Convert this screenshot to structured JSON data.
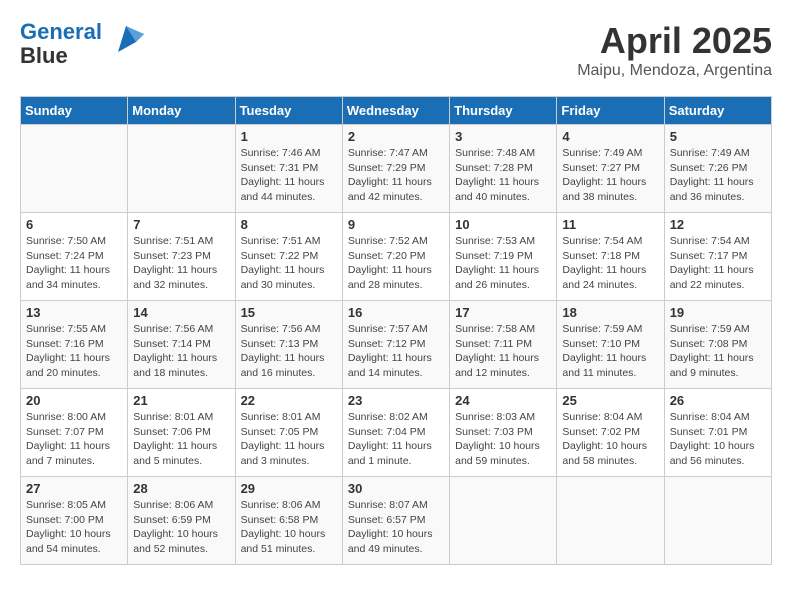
{
  "header": {
    "logo_line1": "General",
    "logo_line2": "Blue",
    "month": "April 2025",
    "location": "Maipu, Mendoza, Argentina"
  },
  "days_of_week": [
    "Sunday",
    "Monday",
    "Tuesday",
    "Wednesday",
    "Thursday",
    "Friday",
    "Saturday"
  ],
  "weeks": [
    [
      {
        "day": "",
        "info": ""
      },
      {
        "day": "",
        "info": ""
      },
      {
        "day": "1",
        "info": "Sunrise: 7:46 AM\nSunset: 7:31 PM\nDaylight: 11 hours and 44 minutes."
      },
      {
        "day": "2",
        "info": "Sunrise: 7:47 AM\nSunset: 7:29 PM\nDaylight: 11 hours and 42 minutes."
      },
      {
        "day": "3",
        "info": "Sunrise: 7:48 AM\nSunset: 7:28 PM\nDaylight: 11 hours and 40 minutes."
      },
      {
        "day": "4",
        "info": "Sunrise: 7:49 AM\nSunset: 7:27 PM\nDaylight: 11 hours and 38 minutes."
      },
      {
        "day": "5",
        "info": "Sunrise: 7:49 AM\nSunset: 7:26 PM\nDaylight: 11 hours and 36 minutes."
      }
    ],
    [
      {
        "day": "6",
        "info": "Sunrise: 7:50 AM\nSunset: 7:24 PM\nDaylight: 11 hours and 34 minutes."
      },
      {
        "day": "7",
        "info": "Sunrise: 7:51 AM\nSunset: 7:23 PM\nDaylight: 11 hours and 32 minutes."
      },
      {
        "day": "8",
        "info": "Sunrise: 7:51 AM\nSunset: 7:22 PM\nDaylight: 11 hours and 30 minutes."
      },
      {
        "day": "9",
        "info": "Sunrise: 7:52 AM\nSunset: 7:20 PM\nDaylight: 11 hours and 28 minutes."
      },
      {
        "day": "10",
        "info": "Sunrise: 7:53 AM\nSunset: 7:19 PM\nDaylight: 11 hours and 26 minutes."
      },
      {
        "day": "11",
        "info": "Sunrise: 7:54 AM\nSunset: 7:18 PM\nDaylight: 11 hours and 24 minutes."
      },
      {
        "day": "12",
        "info": "Sunrise: 7:54 AM\nSunset: 7:17 PM\nDaylight: 11 hours and 22 minutes."
      }
    ],
    [
      {
        "day": "13",
        "info": "Sunrise: 7:55 AM\nSunset: 7:16 PM\nDaylight: 11 hours and 20 minutes."
      },
      {
        "day": "14",
        "info": "Sunrise: 7:56 AM\nSunset: 7:14 PM\nDaylight: 11 hours and 18 minutes."
      },
      {
        "day": "15",
        "info": "Sunrise: 7:56 AM\nSunset: 7:13 PM\nDaylight: 11 hours and 16 minutes."
      },
      {
        "day": "16",
        "info": "Sunrise: 7:57 AM\nSunset: 7:12 PM\nDaylight: 11 hours and 14 minutes."
      },
      {
        "day": "17",
        "info": "Sunrise: 7:58 AM\nSunset: 7:11 PM\nDaylight: 11 hours and 12 minutes."
      },
      {
        "day": "18",
        "info": "Sunrise: 7:59 AM\nSunset: 7:10 PM\nDaylight: 11 hours and 11 minutes."
      },
      {
        "day": "19",
        "info": "Sunrise: 7:59 AM\nSunset: 7:08 PM\nDaylight: 11 hours and 9 minutes."
      }
    ],
    [
      {
        "day": "20",
        "info": "Sunrise: 8:00 AM\nSunset: 7:07 PM\nDaylight: 11 hours and 7 minutes."
      },
      {
        "day": "21",
        "info": "Sunrise: 8:01 AM\nSunset: 7:06 PM\nDaylight: 11 hours and 5 minutes."
      },
      {
        "day": "22",
        "info": "Sunrise: 8:01 AM\nSunset: 7:05 PM\nDaylight: 11 hours and 3 minutes."
      },
      {
        "day": "23",
        "info": "Sunrise: 8:02 AM\nSunset: 7:04 PM\nDaylight: 11 hours and 1 minute."
      },
      {
        "day": "24",
        "info": "Sunrise: 8:03 AM\nSunset: 7:03 PM\nDaylight: 10 hours and 59 minutes."
      },
      {
        "day": "25",
        "info": "Sunrise: 8:04 AM\nSunset: 7:02 PM\nDaylight: 10 hours and 58 minutes."
      },
      {
        "day": "26",
        "info": "Sunrise: 8:04 AM\nSunset: 7:01 PM\nDaylight: 10 hours and 56 minutes."
      }
    ],
    [
      {
        "day": "27",
        "info": "Sunrise: 8:05 AM\nSunset: 7:00 PM\nDaylight: 10 hours and 54 minutes."
      },
      {
        "day": "28",
        "info": "Sunrise: 8:06 AM\nSunset: 6:59 PM\nDaylight: 10 hours and 52 minutes."
      },
      {
        "day": "29",
        "info": "Sunrise: 8:06 AM\nSunset: 6:58 PM\nDaylight: 10 hours and 51 minutes."
      },
      {
        "day": "30",
        "info": "Sunrise: 8:07 AM\nSunset: 6:57 PM\nDaylight: 10 hours and 49 minutes."
      },
      {
        "day": "",
        "info": ""
      },
      {
        "day": "",
        "info": ""
      },
      {
        "day": "",
        "info": ""
      }
    ]
  ]
}
